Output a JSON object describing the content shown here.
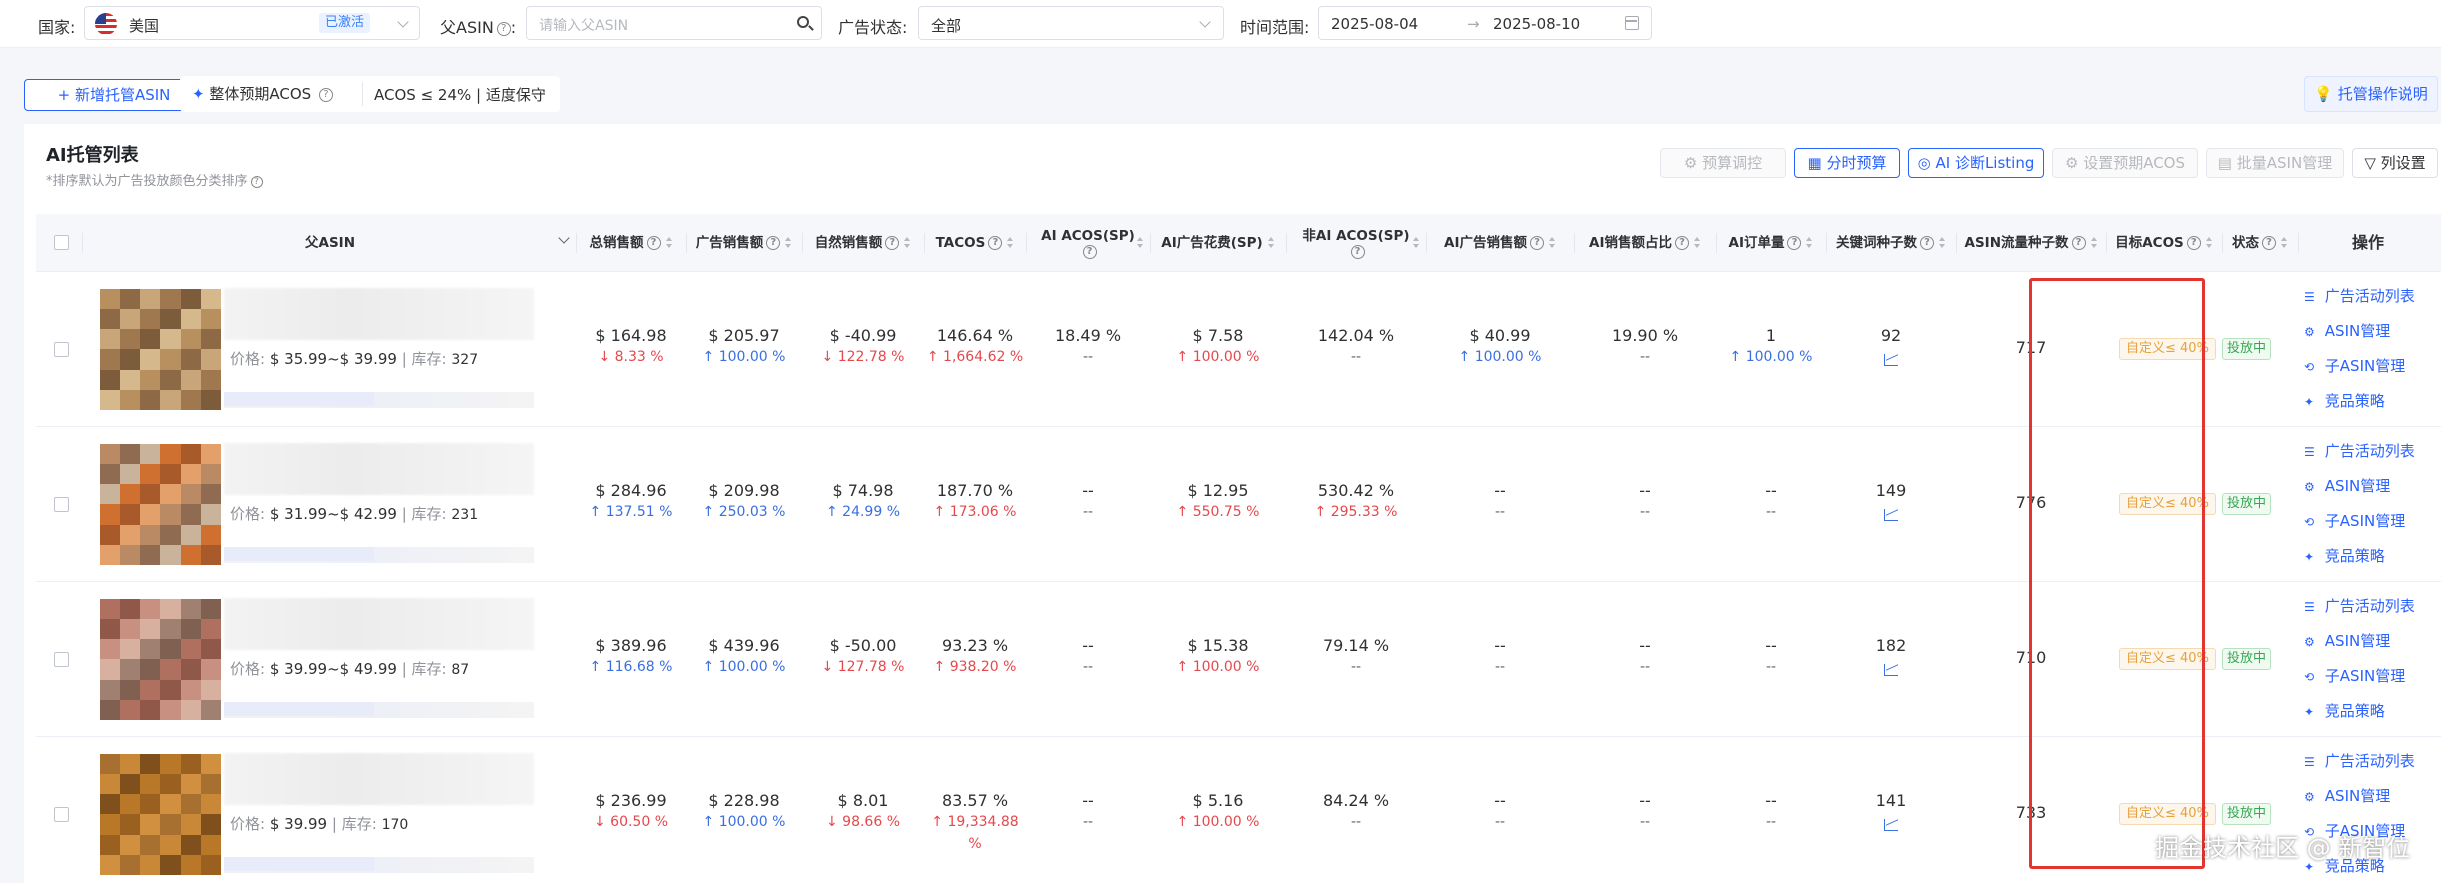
{
  "filters": {
    "country_label": "国家:",
    "country_value": "美国",
    "country_badge": "已激活",
    "parent_asin_label": "父ASIN",
    "parent_asin_placeholder": "请输入父ASIN",
    "ad_status_label": "广告状态:",
    "ad_status_value": "全部",
    "date_label": "时间范围:",
    "date_start": "2025-08-04",
    "date_sep": "→",
    "date_end": "2025-08-10"
  },
  "toolbar": {
    "add_button": "+ 新增托管ASIN",
    "overall_acos_label": "整体预期ACOS",
    "acos_value": "ACOS ≤ 24% | 适度保守",
    "help_button": "托管操作说明"
  },
  "list": {
    "title": "AI托管列表",
    "subtitle": "*排序默认为广告投放颜色分类排序",
    "buttons": {
      "budget_adjust": "预算调控",
      "time_budget": "分时预算",
      "ai_listing": "AI 诊断Listing",
      "set_acos": "设置预期ACOS",
      "batch_asin": "批量ASIN管理",
      "column_settings": "列设置"
    }
  },
  "columns": {
    "parent_asin": "父ASIN",
    "total_sales": "总销售额",
    "ad_sales": "广告销售额",
    "organic_sales": "自然销售额",
    "tacos": "TACOS",
    "ai_acos_sp": "AI ACOS(SP)",
    "ai_ad_spend_sp": "AI广告花费(SP)",
    "non_ai_acos_sp": "非AI ACOS(SP)",
    "ai_ad_sales": "AI广告销售额",
    "ai_sales_share": "AI销售额占比",
    "ai_orders": "AI订单量",
    "keyword_seeds": "关键词种子数",
    "asin_traffic_seeds": "ASIN流量种子数",
    "target_acos": "目标ACOS",
    "status": "状态",
    "actions": "操作"
  },
  "price_label": "价格:",
  "stock_label": "| 库存:",
  "ops": [
    "广告活动列表",
    "ASIN管理",
    "子ASIN管理",
    "竞品策略"
  ],
  "rows": [
    {
      "price": "$ 35.99~$ 39.99",
      "stock": "327",
      "total_sales": "$ 164.98",
      "total_sales_d": "↓ 8.33 %",
      "ad_sales": "$ 205.97",
      "ad_sales_d": "↑ 100.00 %",
      "organic_sales": "$ -40.99",
      "organic_sales_d": "↓ 122.78 %",
      "tacos": "146.64 %",
      "tacos_d": "↑ 1,664.62 %",
      "ai_acos": "18.49 %",
      "ai_acos_d": "--",
      "ai_spend": "$ 7.58",
      "ai_spend_d": "↑ 100.00 %",
      "non_ai_acos": "142.04 %",
      "non_ai_acos_d": "--",
      "ai_ad_sales": "$ 40.99",
      "ai_ad_sales_d": "↑ 100.00 %",
      "ai_share": "19.90 %",
      "ai_share_d": "--",
      "ai_orders": "1",
      "ai_orders_d": "↑ 100.00 %",
      "keyword_seeds": "92",
      "asin_seeds": "717",
      "target_acos": "自定义≤ 40%",
      "status": "投放中"
    },
    {
      "price": "$ 31.99~$ 42.99",
      "stock": "231",
      "total_sales": "$ 284.96",
      "total_sales_d": "↑ 137.51 %",
      "ad_sales": "$ 209.98",
      "ad_sales_d": "↑ 250.03 %",
      "organic_sales": "$ 74.98",
      "organic_sales_d": "↑ 24.99 %",
      "tacos": "187.70 %",
      "tacos_d": "↑ 173.06 %",
      "ai_acos": "--",
      "ai_acos_d": "--",
      "ai_spend": "$ 12.95",
      "ai_spend_d": "↑ 550.75 %",
      "non_ai_acos": "530.42 %",
      "non_ai_acos_d": "↑ 295.33 %",
      "ai_ad_sales": "--",
      "ai_ad_sales_d": "--",
      "ai_share": "--",
      "ai_share_d": "--",
      "ai_orders": "--",
      "ai_orders_d": "--",
      "keyword_seeds": "149",
      "asin_seeds": "776",
      "target_acos": "自定义≤ 40%",
      "status": "投放中"
    },
    {
      "price": "$ 39.99~$ 49.99",
      "stock": "87",
      "total_sales": "$ 389.96",
      "total_sales_d": "↑ 116.68 %",
      "ad_sales": "$ 439.96",
      "ad_sales_d": "↑ 100.00 %",
      "organic_sales": "$ -50.00",
      "organic_sales_d": "↓ 127.78 %",
      "tacos": "93.23 %",
      "tacos_d": "↑ 938.20 %",
      "ai_acos": "--",
      "ai_acos_d": "--",
      "ai_spend": "$ 15.38",
      "ai_spend_d": "↑ 100.00 %",
      "non_ai_acos": "79.14 %",
      "non_ai_acos_d": "--",
      "ai_ad_sales": "--",
      "ai_ad_sales_d": "--",
      "ai_share": "--",
      "ai_share_d": "--",
      "ai_orders": "--",
      "ai_orders_d": "--",
      "keyword_seeds": "182",
      "asin_seeds": "710",
      "target_acos": "自定义≤ 40%",
      "status": "投放中"
    },
    {
      "price": "$ 39.99",
      "stock": "170",
      "total_sales": "$ 236.99",
      "total_sales_d": "↓ 60.50 %",
      "ad_sales": "$ 228.98",
      "ad_sales_d": "↑ 100.00 %",
      "organic_sales": "$ 8.01",
      "organic_sales_d": "↓ 98.66 %",
      "tacos": "83.57 %",
      "tacos_d": "↑ 19,334.88 %",
      "ai_acos": "--",
      "ai_acos_d": "--",
      "ai_spend": "$ 5.16",
      "ai_spend_d": "↑ 100.00 %",
      "non_ai_acos": "84.24 %",
      "non_ai_acos_d": "--",
      "ai_ad_sales": "--",
      "ai_ad_sales_d": "--",
      "ai_share": "--",
      "ai_share_d": "--",
      "ai_orders": "--",
      "ai_orders_d": "--",
      "keyword_seeds": "141",
      "asin_seeds": "733",
      "target_acos": "自定义≤ 40%",
      "status": "投放中"
    }
  ],
  "watermark": "掘金技术社区 @ 新智位"
}
